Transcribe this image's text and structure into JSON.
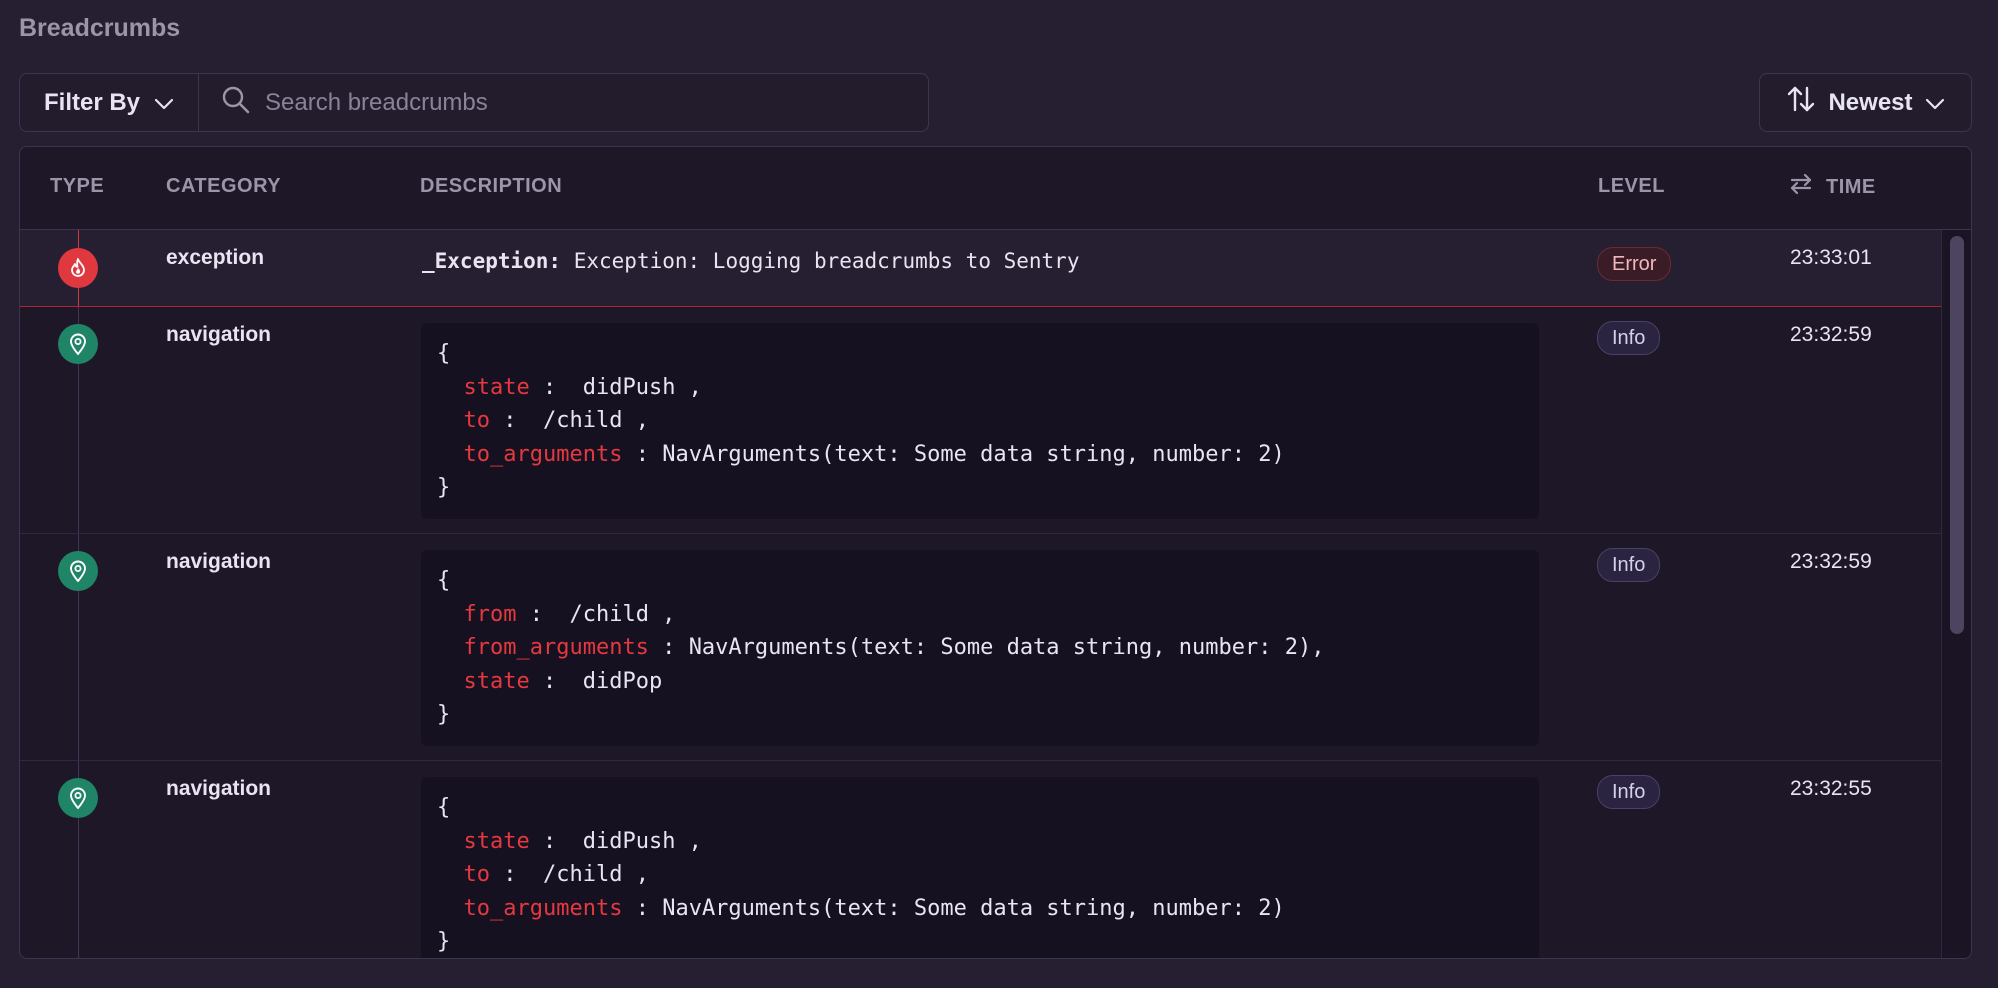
{
  "section_title": "Breadcrumbs",
  "toolbar": {
    "filter_label": "Filter By",
    "search_placeholder": "Search breadcrumbs",
    "sort_label": "Newest"
  },
  "table": {
    "headers": {
      "type": "TYPE",
      "category": "CATEGORY",
      "description": "DESCRIPTION",
      "level": "LEVEL",
      "time": "TIME"
    }
  },
  "rows": [
    {
      "type_icon": "fire-icon",
      "category": "exception",
      "exception_type": "_Exception:",
      "exception_message": "Exception: Logging breadcrumbs to Sentry",
      "level": "Error",
      "time": "23:33:01"
    },
    {
      "type_icon": "location-pin-icon",
      "category": "navigation",
      "open_brace": "{",
      "lines": [
        {
          "key": "state",
          "sep": " :  ",
          "value": "didPush ,"
        },
        {
          "key": "to",
          "sep": " :  ",
          "value": "/child ,"
        },
        {
          "key": "to_arguments",
          "sep": " : ",
          "value": "NavArguments(text: Some data string, number: 2)"
        }
      ],
      "close_brace": "}",
      "level": "Info",
      "time": "23:32:59"
    },
    {
      "type_icon": "location-pin-icon",
      "category": "navigation",
      "open_brace": "{",
      "lines": [
        {
          "key": "from",
          "sep": " :  ",
          "value": "/child ,"
        },
        {
          "key": "from_arguments",
          "sep": " : ",
          "value": "NavArguments(text: Some data string, number: 2),"
        },
        {
          "key": "state",
          "sep": " :  ",
          "value": "didPop"
        }
      ],
      "close_brace": "}",
      "level": "Info",
      "time": "23:32:59"
    },
    {
      "type_icon": "location-pin-icon",
      "category": "navigation",
      "open_brace": "{",
      "lines": [
        {
          "key": "state",
          "sep": " :  ",
          "value": "didPush ,"
        },
        {
          "key": "to",
          "sep": " :  ",
          "value": "/child ,"
        },
        {
          "key": "to_arguments",
          "sep": " : ",
          "value": "NavArguments(text: Some data string, number: 2)"
        }
      ],
      "close_brace": "}",
      "level": "Info",
      "time": "23:32:55"
    }
  ],
  "colors": {
    "background": "#251f31",
    "error": "#e0383f",
    "nav": "#208466",
    "code_key": "#e5383f"
  }
}
